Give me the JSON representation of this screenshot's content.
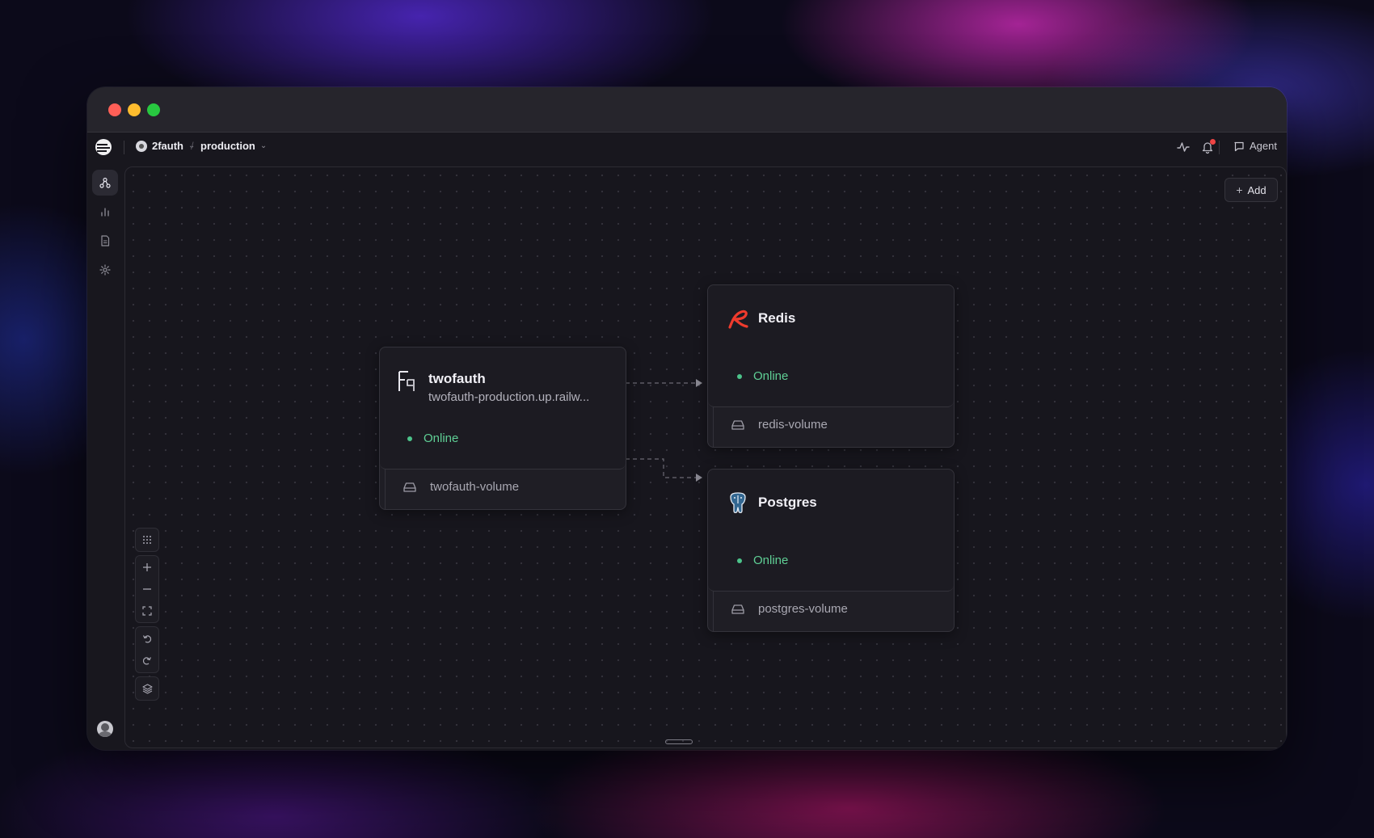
{
  "topbar": {
    "project_name": "2fauth",
    "environment": "production",
    "agent_label": "Agent"
  },
  "sidebar": {
    "items": [
      {
        "name": "architecture",
        "icon": "nodes-icon",
        "active": true
      },
      {
        "name": "metrics",
        "icon": "bar-chart-icon",
        "active": false
      },
      {
        "name": "logs",
        "icon": "document-icon",
        "active": false
      },
      {
        "name": "settings",
        "icon": "gear-icon",
        "active": false
      }
    ]
  },
  "canvas": {
    "add_label": "Add",
    "services": {
      "twofauth": {
        "name": "twofauth",
        "url": "twofauth-production.up.railw...",
        "status": "Online",
        "volume": "twofauth-volume"
      },
      "redis": {
        "name": "Redis",
        "status": "Online",
        "volume": "redis-volume"
      },
      "postgres": {
        "name": "Postgres",
        "status": "Online",
        "volume": "postgres-volume"
      }
    },
    "controls": [
      "grid-icon",
      "zoom-in-icon",
      "zoom-out-icon",
      "fit-view-icon",
      "undo-icon",
      "redo-icon",
      "layers-icon"
    ]
  },
  "colors": {
    "status_online": "#5fcf95",
    "redis_brand": "#ef3b2d",
    "postgres_brand": "#336791",
    "notification": "#ef4444"
  }
}
